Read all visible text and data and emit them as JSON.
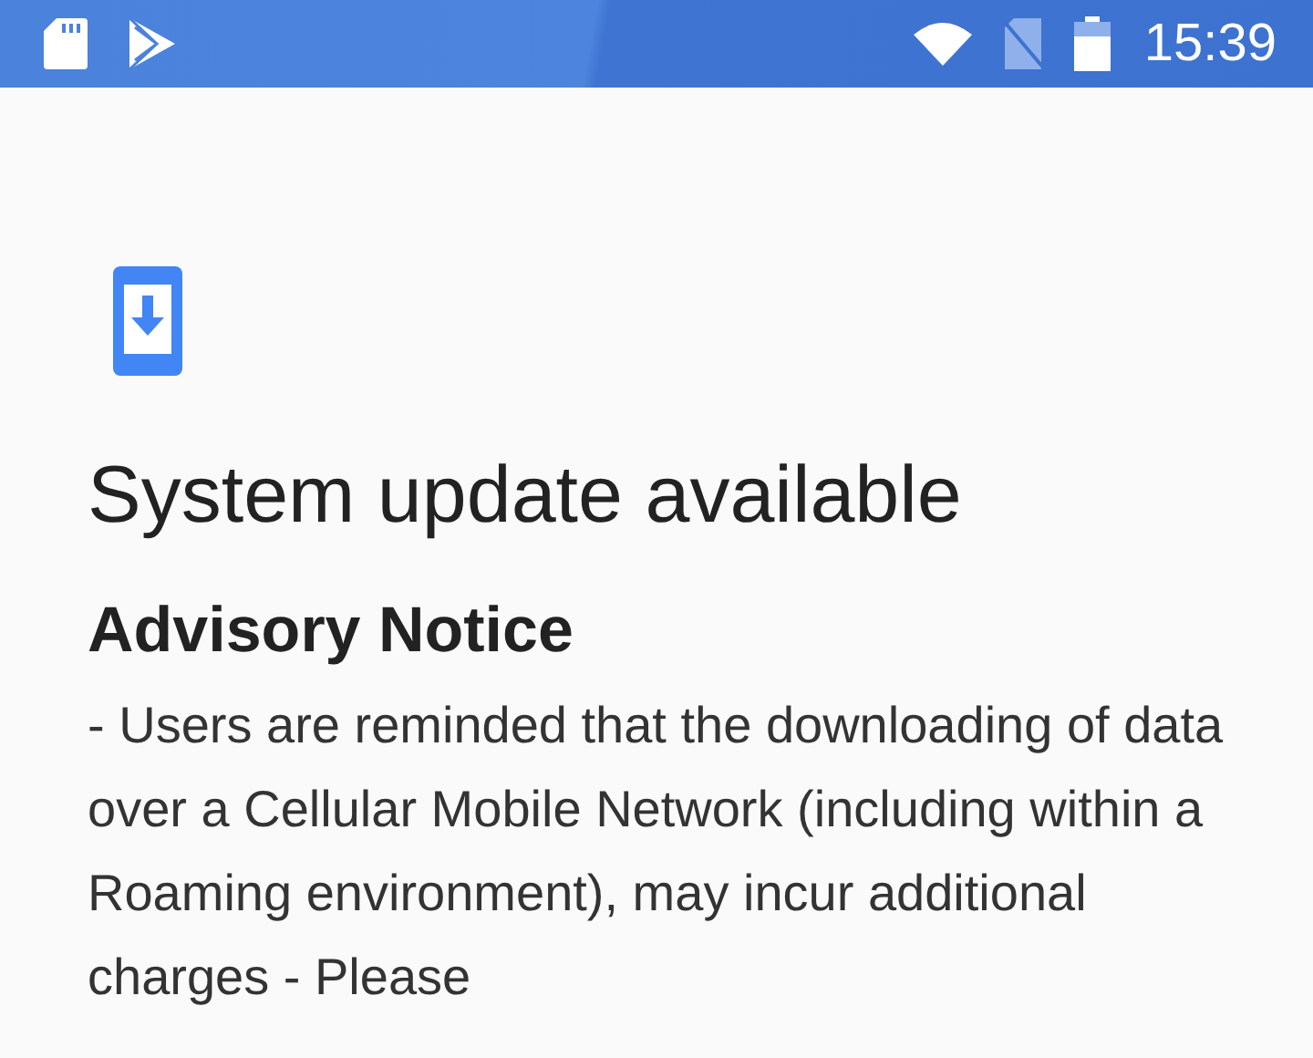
{
  "status_bar": {
    "time": "15:39"
  },
  "title": "System update available",
  "notice": {
    "heading": "Advisory Notice",
    "text": "- Users are reminded that the downloading of data over a Cellular Mobile Network (including within a Roaming environment), may incur additional charges - Please"
  }
}
